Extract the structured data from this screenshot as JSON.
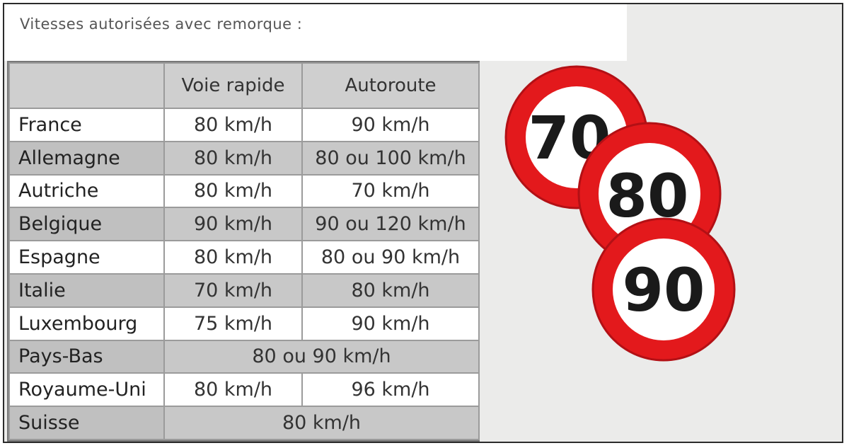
{
  "title": "Vitesses autorisées avec remorque :",
  "table": {
    "headers": [
      "",
      "Voie rapide",
      "Autoroute"
    ],
    "rows": [
      {
        "country": "France",
        "voie_rapide": "80 km/h",
        "autoroute": "90 km/h"
      },
      {
        "country": "Allemagne",
        "voie_rapide": "80 km/h",
        "autoroute": "80 ou 100 km/h"
      },
      {
        "country": "Autriche",
        "voie_rapide": "80 km/h",
        "autoroute": "70 km/h"
      },
      {
        "country": "Belgique",
        "voie_rapide": "90 km/h",
        "autoroute": "90 ou 120 km/h"
      },
      {
        "country": "Espagne",
        "voie_rapide": "80 km/h",
        "autoroute": "80 ou 90 km/h"
      },
      {
        "country": "Italie",
        "voie_rapide": "70 km/h",
        "autoroute": "80 km/h"
      },
      {
        "country": "Luxembourg",
        "voie_rapide": "75 km/h",
        "autoroute": "90 km/h"
      },
      {
        "country": "Pays-Bas",
        "both": "80 ou 90 km/h"
      },
      {
        "country": "Royaume-Uni",
        "voie_rapide": "80 km/h",
        "autoroute": "96 km/h"
      },
      {
        "country": "Suisse",
        "both": "80 km/h"
      }
    ]
  },
  "signs": [
    {
      "value": "70",
      "icon": "speed-limit-70-icon"
    },
    {
      "value": "80",
      "icon": "speed-limit-80-icon"
    },
    {
      "value": "90",
      "icon": "speed-limit-90-icon"
    }
  ],
  "colors": {
    "sign_red": "#e3191c",
    "sign_text": "#1a1a1a",
    "even_row": "#c8c8c8",
    "header": "#cfcfcf"
  }
}
